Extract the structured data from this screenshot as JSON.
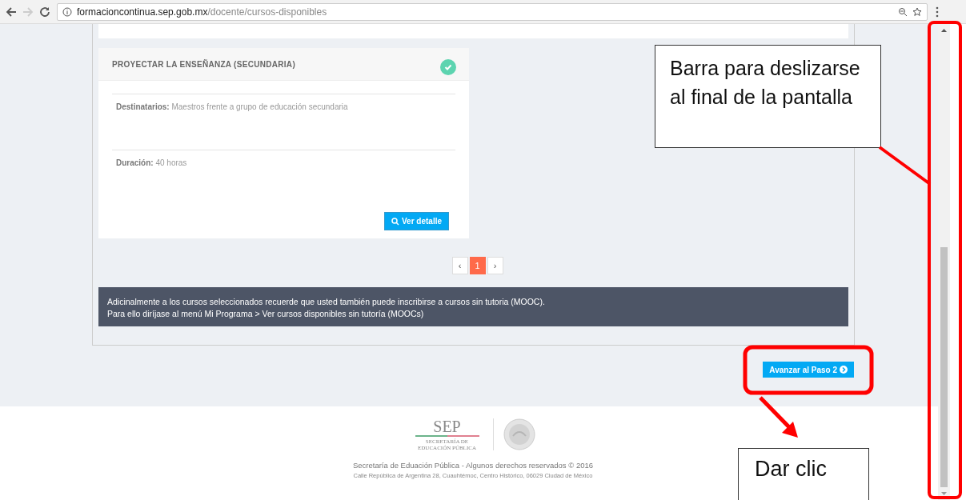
{
  "browser": {
    "url_host": "formacioncontinua.sep.gob.mx",
    "url_path": "/docente/cursos-disponibles"
  },
  "course_card": {
    "title": "PROYECTAR LA ENSEÑANZA (SECUNDARIA)",
    "selected": true,
    "fields": [
      {
        "label": "Destinatarios:",
        "value": "Maestros frente a grupo de educación secundaria"
      },
      {
        "label": "Duración:",
        "value": "40 horas"
      }
    ],
    "detail_button": "Ver detalle"
  },
  "pagination": {
    "prev": "‹",
    "pages": [
      {
        "label": "1",
        "selected": true
      }
    ],
    "next": "›"
  },
  "notice": [
    "Adicinalmente a los cursos seleccionados recuerde que usted también puede inscribirse a cursos sin tutoria (MOOC).",
    "Para ello diríjase al menú Mi Programa > Ver cursos disponibles sin tutoría (MOOCs)"
  ],
  "next_button": "Avanzar al Paso 2",
  "footer": {
    "logo_text": "SEP",
    "logo_subtitle": [
      "SECRETARÍA DE",
      "EDUCACIÓN PÚBLICA"
    ],
    "copyright": "Secretaría de Eduación Pública - Algunos derechos reservados © 2016",
    "address": "Calle República de Argentina 28, Cuauhtémoc, Centro Histórico, 06029 Ciudad de México"
  },
  "annotations": [
    {
      "kind": "callout",
      "text": "Barra para deslizarse al final de la pantalla"
    },
    {
      "kind": "callout",
      "text": "Dar clic"
    }
  ]
}
